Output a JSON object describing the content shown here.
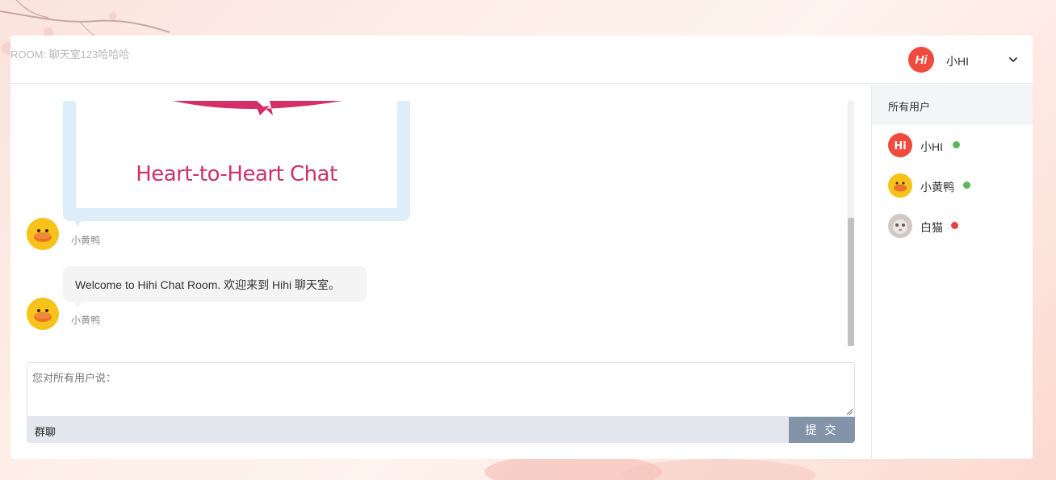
{
  "header": {
    "room_title": "ROOM: 聊天室123哈哈哈",
    "current_user": {
      "name": "小HI",
      "avatar_text": "Hi",
      "avatar_icon": "hi-logo-icon"
    },
    "menu_icon": "chevron-down-icon"
  },
  "messages": [
    {
      "type": "image",
      "sender": "小黄鸭",
      "avatar_icon": "duck-avatar-icon",
      "image_caption": "Heart-to-Heart Chat"
    },
    {
      "type": "text",
      "sender": "小黄鸭",
      "avatar_icon": "duck-avatar-icon",
      "text": "Welcome to Hihi Chat Room. 欢迎来到 Hihi 聊天室。"
    }
  ],
  "composer": {
    "placeholder": "您对所有用户说：",
    "mode_label": "群聊",
    "submit_label": "提 交"
  },
  "sidebar": {
    "title": "所有用户",
    "users": [
      {
        "name": "小HI",
        "avatar_icon": "hi-logo-icon",
        "status": "online",
        "status_color": "#5cb85c"
      },
      {
        "name": "小黄鸭",
        "avatar_icon": "duck-avatar-icon",
        "status": "online",
        "status_color": "#5cb85c"
      },
      {
        "name": "白猫",
        "avatar_icon": "cat-avatar-icon",
        "status": "offline",
        "status_color": "#e84545"
      }
    ]
  },
  "colors": {
    "accent_red": "#ef4b3f",
    "brand_pink": "#c8336a",
    "submit_button": "#8494a8",
    "online": "#5cb85c",
    "offline": "#e84545"
  }
}
